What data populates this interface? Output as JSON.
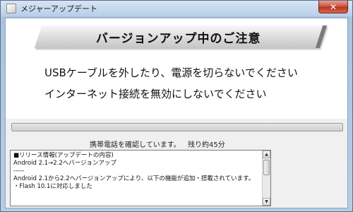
{
  "window": {
    "title": "メジャーアップデート",
    "close_label": "✕"
  },
  "banner": {
    "title": "バージョンアップ中のご注意"
  },
  "warnings": [
    "USBケーブルを外したり、電源を切らないでください",
    "インターネット接続を無効にしないでください"
  ],
  "progress": {
    "value_percent": 0
  },
  "status": {
    "message": "携帯電話を確認しています。",
    "remaining": "残り約45分"
  },
  "release_info": {
    "lines": [
      "■リリース情報(アップデートの内容)",
      "Android 2.1→2.2へバージョンアップ",
      "-----",
      "Android 2.1から2.2へバージョンアップにより、以下の機能が追加・搭載されています。",
      "・Flash 10.1に対応しました"
    ]
  }
}
